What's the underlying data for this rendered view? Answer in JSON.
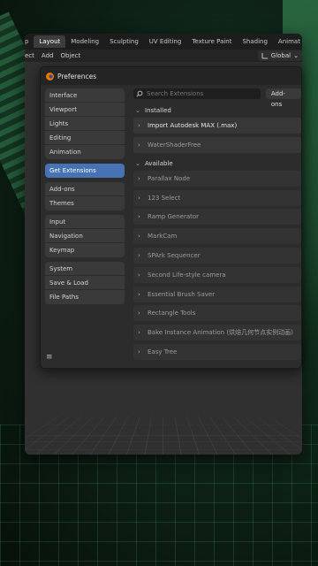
{
  "workspace_tabs": {
    "stub": "p",
    "items": [
      "Layout",
      "Modeling",
      "Sculpting",
      "UV Editing",
      "Texture Paint",
      "Shading",
      "Animat"
    ]
  },
  "menubar": {
    "items": [
      "ect",
      "Add",
      "Object"
    ],
    "transform_orientation": "Global"
  },
  "preferences": {
    "title": "Preferences",
    "nav_groups": [
      [
        "Interface",
        "Viewport",
        "Lights",
        "Editing",
        "Animation"
      ],
      [
        "Get Extensions"
      ],
      [
        "Add-ons",
        "Themes"
      ],
      [
        "Input",
        "Navigation",
        "Keymap"
      ],
      [
        "System",
        "Save & Load",
        "File Paths"
      ]
    ],
    "active_nav": "Get Extensions",
    "search_placeholder": "Search Extensions",
    "filter_label": "Add-ons",
    "installed_label": "Installed",
    "installed": [
      "Import Autodesk MAX (.max)",
      "WaterShaderFree"
    ],
    "available_label": "Available",
    "available": [
      "Parallax Node",
      "123 Select",
      "Ramp Generator",
      "MarkCam",
      "SPArk Sequencer",
      "Second Life-style camera",
      "Essential Brush Saver",
      "Rectangle Tools",
      "Bake Instance Animation (烘焙几何节点实例动画)",
      "Easy Tree"
    ]
  },
  "colors": {
    "accent": "#4772b3",
    "panel": "#2c2c2c",
    "background_glow": "#1f4a30"
  }
}
